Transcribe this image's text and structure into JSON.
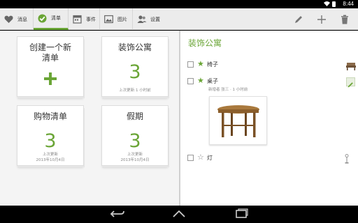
{
  "status": {
    "time": "8:44"
  },
  "tabs": [
    {
      "label": "消息",
      "icon": "heart-icon"
    },
    {
      "label": "清单",
      "icon": "check-circle-icon"
    },
    {
      "label": "事件",
      "icon": "calendar-icon"
    },
    {
      "label": "图片",
      "icon": "image-icon"
    },
    {
      "label": "设置",
      "icon": "people-icon"
    }
  ],
  "actions": [
    {
      "name": "edit",
      "icon": "pencil-icon"
    },
    {
      "name": "add",
      "icon": "plus-icon"
    },
    {
      "name": "delete",
      "icon": "trash-icon"
    }
  ],
  "cards": {
    "create": {
      "title": "创建一个新清单"
    },
    "decor": {
      "title": "装饰公寓",
      "count": "3",
      "meta": "上次更新 1 小时前"
    },
    "shopping": {
      "title": "购物清单",
      "count": "3",
      "meta1": "上次更新",
      "meta2": "2013年10月4日"
    },
    "holiday": {
      "title": "假期",
      "count": "3",
      "meta1": "上次更新",
      "meta2": "2013年10月4日"
    }
  },
  "detail": {
    "title": "装饰公寓",
    "items": [
      {
        "label": "椅子",
        "starred": true,
        "thumb": "chair-thumbnail"
      },
      {
        "label": "桌子",
        "starred": true,
        "sub": "新增者 张三 · 1 小时前",
        "thumb": "pencil-icon"
      },
      {
        "label": "灯",
        "starred": false,
        "thumb": "lamp-thumbnail"
      }
    ]
  },
  "colors": {
    "accent": "#6aa536",
    "actionbar": "#ececec"
  }
}
